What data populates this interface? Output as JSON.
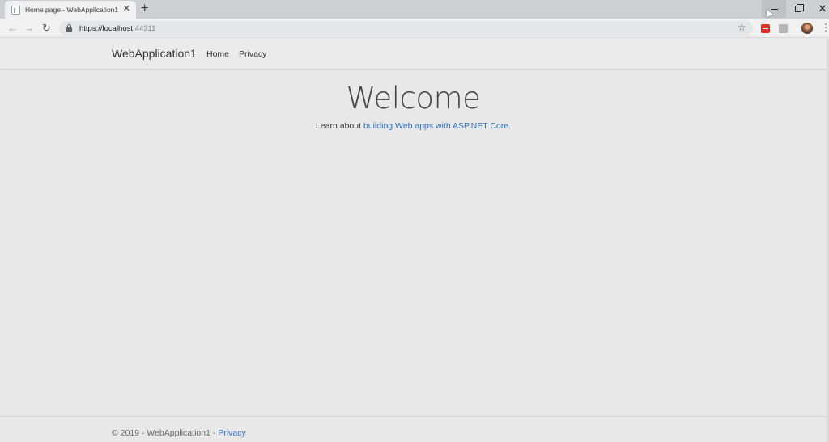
{
  "browser": {
    "tab": {
      "title": "Home page - WebApplication1",
      "close_label": "✕"
    },
    "new_tab_label": "+",
    "window": {
      "minimize_label": "",
      "maximize_label": "",
      "close_label": "✕"
    },
    "nav": {
      "back": "←",
      "forward": "→",
      "reload": "↻"
    },
    "address": {
      "scheme": "https://",
      "host": "localhost",
      "port": ":44311"
    },
    "star_label": "☆",
    "menu_label": "⋮"
  },
  "site": {
    "brand": "WebApplication1",
    "nav_items": [
      {
        "label": "Home"
      },
      {
        "label": "Privacy"
      }
    ]
  },
  "main": {
    "heading": "Welcome",
    "learn_prefix": "Learn about ",
    "learn_link": "building Web apps with ASP.NET Core",
    "learn_suffix": "."
  },
  "footer": {
    "text": "© 2019 - WebApplication1 - ",
    "privacy_link": "Privacy"
  },
  "colors": {
    "link": "#2f6fbf",
    "page_bg": "#e8e8e8",
    "chrome_bg": "#cdcfd2"
  },
  "icons": [
    "page-icon",
    "close-icon",
    "plus-icon",
    "minimize-icon",
    "maximize-icon",
    "back-arrow-icon",
    "forward-arrow-icon",
    "reload-icon",
    "lock-icon",
    "star-icon",
    "extension-icon",
    "avatar",
    "menu-icon"
  ]
}
